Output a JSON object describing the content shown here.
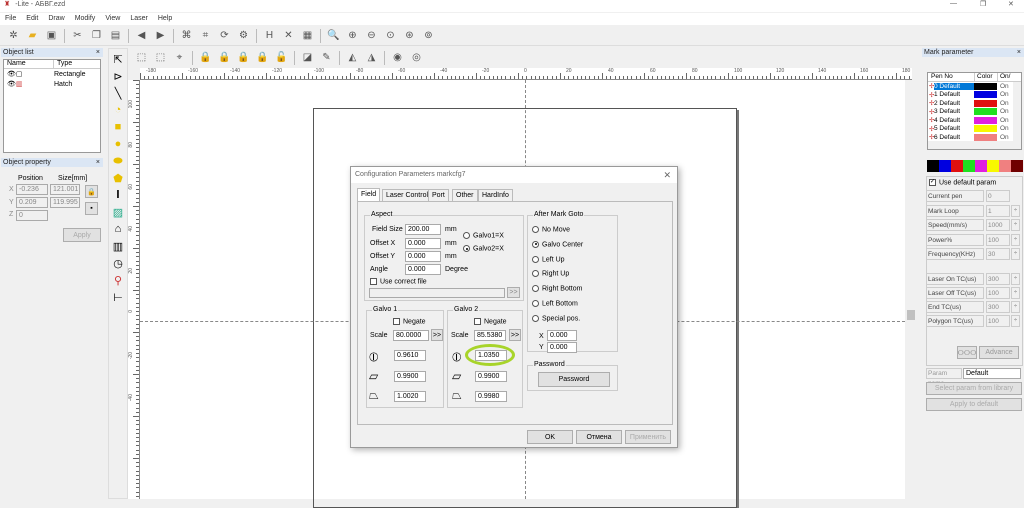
{
  "window": {
    "title": "-Lite - АБВГ.ezd"
  },
  "menu": [
    "File",
    "Edit",
    "Draw",
    "Modify",
    "View",
    "Laser",
    "Help"
  ],
  "object_list": {
    "title": "Object list",
    "columns": [
      "Name",
      "Type"
    ],
    "rows": [
      {
        "type": "Rectangle"
      },
      {
        "type": "Hatch"
      }
    ]
  },
  "object_property": {
    "title": "Object property",
    "position_label": "Position",
    "size_label": "Size[mm]",
    "x_label": "X",
    "y_label": "Y",
    "z_label": "Z",
    "x": "-0.236",
    "y": "0.209",
    "z": "0",
    "size_x": "121.001",
    "size_y": "119.995",
    "apply": "Apply"
  },
  "ruler": {
    "top": [
      "-180",
      "-160",
      "-140",
      "-120",
      "-100",
      "-80",
      "-60",
      "-40",
      "-20",
      "0",
      "20",
      "40",
      "60",
      "80",
      "100",
      "120",
      "140",
      "160",
      "180"
    ],
    "left": [
      "100",
      "80",
      "60",
      "40",
      "20",
      "0",
      "-20",
      "-40"
    ]
  },
  "dialog": {
    "title": "Configuration Parameters markcfg7",
    "tabs": [
      "Field",
      "Laser Control",
      "Port",
      "Other",
      "HardInfo"
    ],
    "aspect": {
      "label": "Aspect",
      "field_size_label": "Field Size",
      "field_size": "200.00",
      "offset_x_label": "Offset X",
      "offset_x": "0.000",
      "offset_y_label": "Offset Y",
      "offset_y": "0.000",
      "angle_label": "Angle",
      "angle": "0.000",
      "mm": "mm",
      "degree": "Degree",
      "galvo1x": "Galvo1=X",
      "galvo2x": "Galvo2=X",
      "use_correct_file": "Use correct file",
      "browse": ">>"
    },
    "galvo1": {
      "label": "Galvo 1",
      "negate": "Negate",
      "scale_label": "Scale",
      "scale": "80.0000",
      "more": ">>",
      "v1": "0.9610",
      "v2": "0.9900",
      "v3": "1.0020"
    },
    "galvo2": {
      "label": "Galvo 2",
      "negate": "Negate",
      "scale_label": "Scale",
      "scale": "85.5380",
      "more": ">>",
      "v1": "1.0350",
      "v2": "0.9900",
      "v3": "0.9980"
    },
    "after_mark": {
      "label": "After Mark Goto",
      "options": [
        "No Move",
        "Galvo Center",
        "Left Up",
        "Right Up",
        "Right Bottom",
        "Left Bottom",
        "Special pos."
      ],
      "selected": "Galvo Center",
      "x_label": "X",
      "x": "0.000",
      "y_label": "Y",
      "y": "0.000"
    },
    "password": {
      "label": "Password",
      "button": "Password"
    },
    "ok": "OK",
    "cancel": "Отмена",
    "apply": "Применить",
    "highlight_color": "#a8d42a"
  },
  "mark_parameter": {
    "title": "Mark parameter",
    "columns": [
      "Pen No",
      "Color",
      "On/"
    ],
    "pens": [
      {
        "name": "0 Default",
        "color": "#000000",
        "on": "On"
      },
      {
        "name": "1 Default",
        "color": "#0000e0",
        "on": "On"
      },
      {
        "name": "2 Default",
        "color": "#e01010",
        "on": "On"
      },
      {
        "name": "3 Default",
        "color": "#20e020",
        "on": "On"
      },
      {
        "name": "4 Default",
        "color": "#e020e0",
        "on": "On"
      },
      {
        "name": "5 Default",
        "color": "#f8f800",
        "on": "On"
      },
      {
        "name": "6 Default",
        "color": "#f08080",
        "on": "On"
      }
    ],
    "palette": [
      "#000000",
      "#0000e0",
      "#e01010",
      "#20e020",
      "#e020e0",
      "#f8f800",
      "#f08080",
      "#700000"
    ],
    "use_default_param": "Use default param",
    "params": [
      {
        "k": "Current pen",
        "v": "0",
        "spin": false
      },
      {
        "k": "Mark Loop",
        "v": "1",
        "spin": true
      },
      {
        "k": "Speed(mm/s)",
        "v": "1000",
        "spin": true
      },
      {
        "k": "Power%",
        "v": "100",
        "spin": true
      },
      {
        "k": "Frequency(KHz)",
        "v": "30",
        "spin": true
      }
    ],
    "tc_params": [
      {
        "k": "Laser On TC(us)",
        "v": "300"
      },
      {
        "k": "Laser Off TC(us)",
        "v": "100"
      },
      {
        "k": "End TC(us)",
        "v": "300"
      },
      {
        "k": "Polygon TC(us)",
        "v": "100"
      }
    ],
    "advance": "Advance",
    "wobble": "ⵔⵔⵔ",
    "param_name_label": "Param name",
    "param_name": "Default",
    "select_library": "Select param from library",
    "apply_default": "Apply to default"
  }
}
